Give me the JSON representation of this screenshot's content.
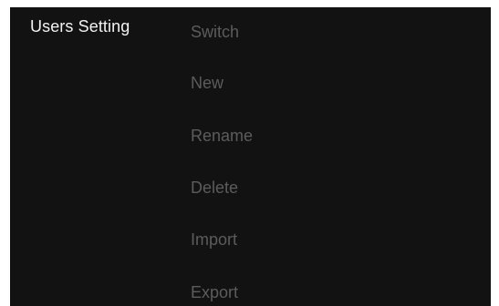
{
  "section_title": "Users Setting",
  "menu": {
    "items": [
      {
        "label": "Switch"
      },
      {
        "label": "New"
      },
      {
        "label": "Rename"
      },
      {
        "label": "Delete"
      },
      {
        "label": "Import"
      },
      {
        "label": "Export"
      }
    ]
  },
  "colors": {
    "panel_background": "#121212",
    "title_text": "#f2f2f2",
    "menu_text": "#5c5c5c"
  }
}
